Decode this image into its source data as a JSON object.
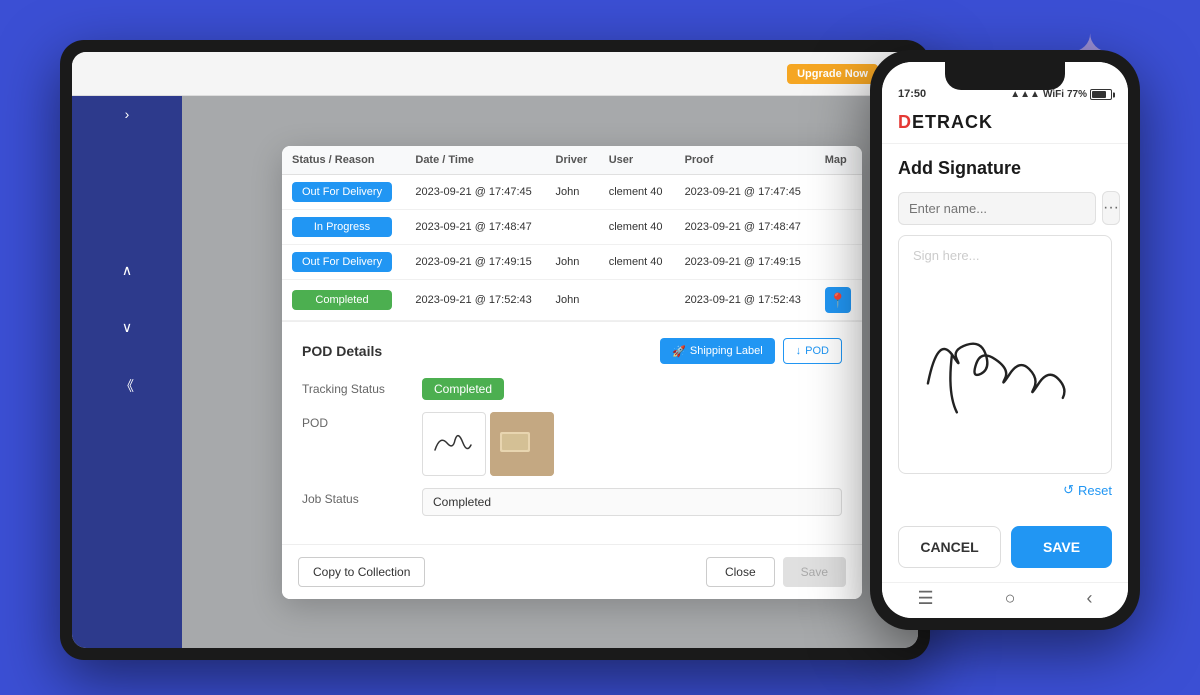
{
  "background": {
    "color": "#3B4FD4"
  },
  "star": {
    "color": "#9B8FD4"
  },
  "tablet": {
    "topbar": {
      "upgrade_label": "Upgrade Now",
      "help_label": "?"
    },
    "modal": {
      "table": {
        "headers": [
          "Status / Reason",
          "Date / Time",
          "Driver",
          "User",
          "Proof",
          "Map"
        ],
        "rows": [
          {
            "status": "Out For Delivery",
            "status_type": "delivery",
            "datetime": "2023-09-21 @ 17:47:45",
            "driver": "John",
            "user": "clement 40",
            "proof": "2023-09-21 @ 17:47:45",
            "map": ""
          },
          {
            "status": "In Progress",
            "status_type": "inprogress",
            "datetime": "2023-09-21 @ 17:48:47",
            "driver": "",
            "user": "clement 40",
            "proof": "2023-09-21 @ 17:48:47",
            "map": ""
          },
          {
            "status": "Out For Delivery",
            "status_type": "delivery",
            "datetime": "2023-09-21 @ 17:49:15",
            "driver": "John",
            "user": "clement 40",
            "proof": "2023-09-21 @ 17:49:15",
            "map": ""
          },
          {
            "status": "Completed",
            "status_type": "completed",
            "datetime": "2023-09-21 @ 17:52:43",
            "driver": "John",
            "user": "",
            "proof": "2023-09-21 @ 17:52:43",
            "map": "📍"
          }
        ]
      },
      "pod_section": {
        "title": "POD Details",
        "shipping_label": "Shipping Label",
        "pod_label": "↓ POD",
        "tracking_status_label": "Tracking Status",
        "tracking_status_value": "Completed",
        "pod_label_field": "POD",
        "job_status_label": "Job Status",
        "job_status_value": "Completed"
      },
      "footer": {
        "copy_label": "Copy to Collection",
        "close_label": "Close",
        "save_label": "Save"
      }
    }
  },
  "phone": {
    "status_bar": {
      "time": "17:50",
      "battery": "77%",
      "signal": "●●●"
    },
    "logo": "DETRACK",
    "add_signature": {
      "title": "Add Signature",
      "name_placeholder": "Enter name...",
      "sign_placeholder": "Sign here...",
      "reset_label": "Reset"
    },
    "footer": {
      "cancel_label": "CANCEL",
      "save_label": "SAVE"
    }
  }
}
